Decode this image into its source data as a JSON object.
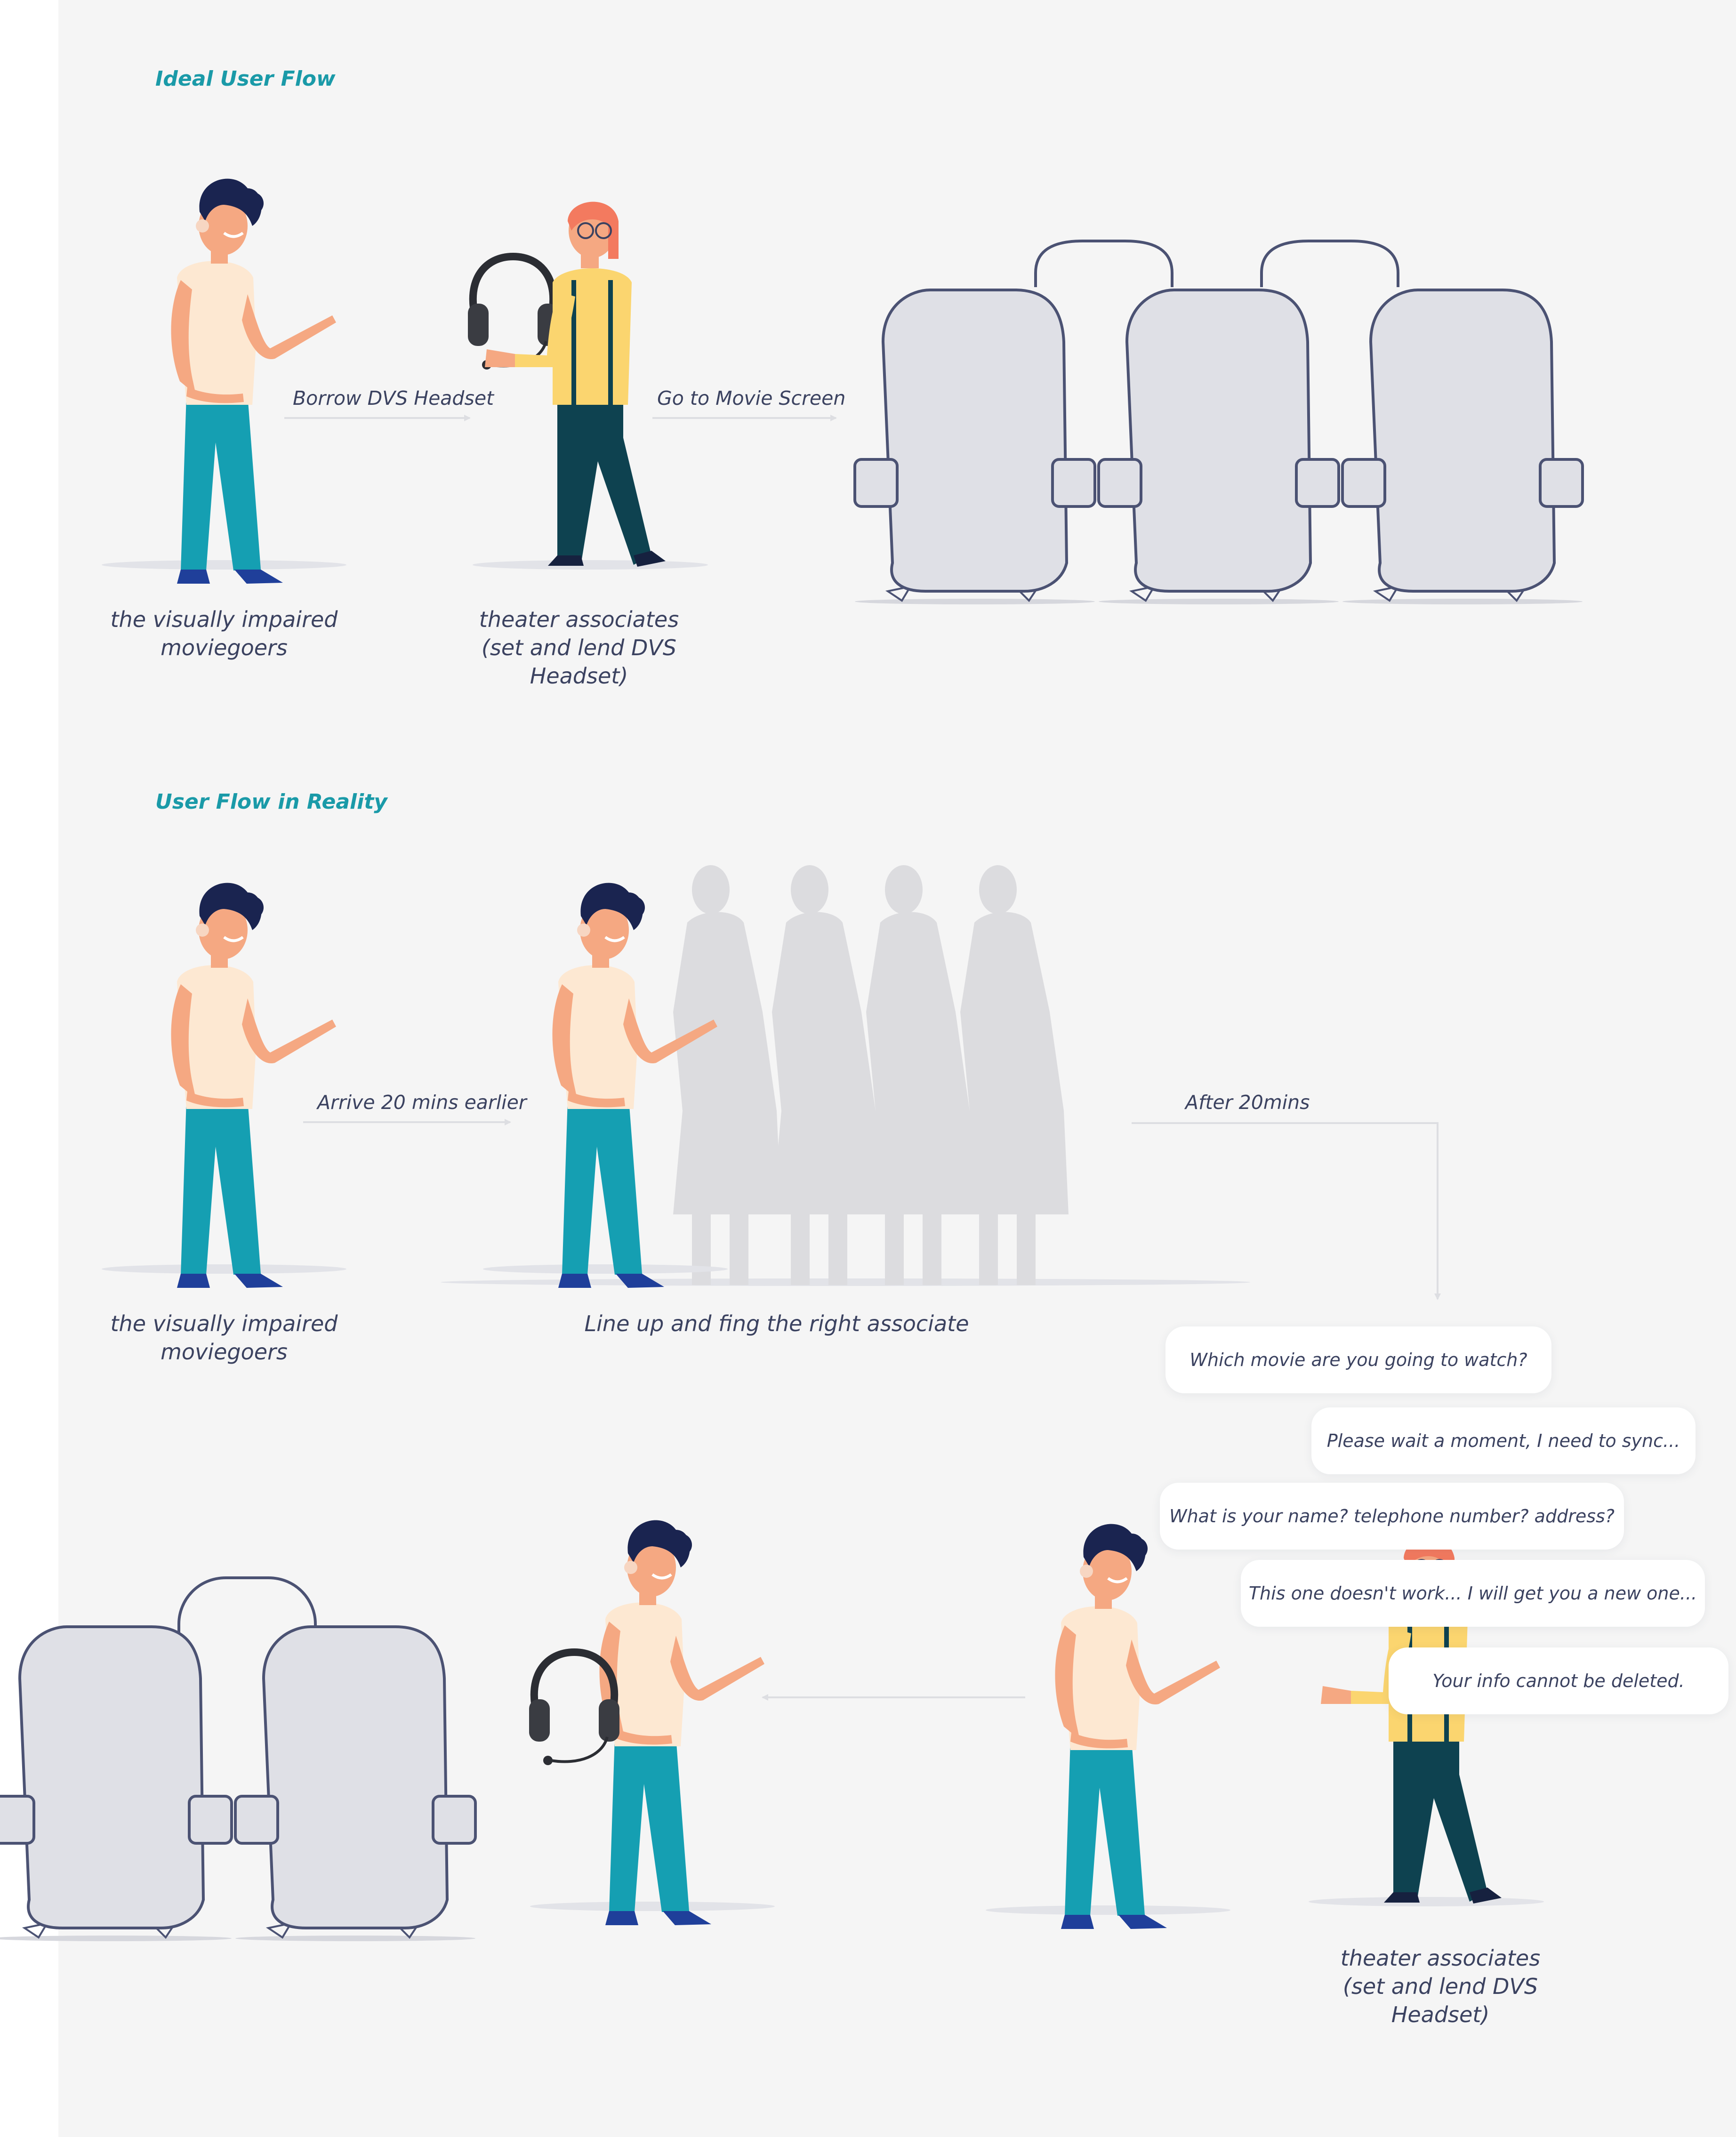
{
  "sections": {
    "ideal": {
      "title": "Ideal User Flow",
      "step1_label": "Borrow DVS Headset",
      "step2_label": "Go to Movie Screen",
      "moviegoer_caption": [
        "the visually impaired",
        "moviegoers"
      ],
      "associate_caption": [
        "theater associates",
        "(set and lend DVS Headset)"
      ]
    },
    "reality": {
      "title": "User Flow in Reality",
      "step1_label": "Arrive 20 mins earlier",
      "step2_label": "After 20mins",
      "moviegoer_caption": [
        "the visually impaired",
        "moviegoers"
      ],
      "queue_caption": "Line up and fing the right associate",
      "associate_caption": [
        "theater associates",
        "(set and lend DVS Headset)"
      ],
      "dialogue": [
        "Which movie are you going to watch?",
        "Please wait a moment, I need to sync...",
        "What is your name? telephone number? address?",
        "This one doesn't work... I will get you a new one...",
        "Your info cannot be deleted."
      ]
    }
  },
  "colors": {
    "accent": "#1a9aa8",
    "text": "#3b4260",
    "seat_fill": "#dfe0e6",
    "seat_outline": "#4b5273",
    "skin": "#f5a882",
    "shirt": "#fde8d2",
    "pants": "#159fb2",
    "hair": "#1a2450",
    "associate_hair": "#f37a5f",
    "associate_shirt": "#fbd56f",
    "associate_pants": "#0e4250",
    "queue_silhouette": "#dcdcdf"
  }
}
